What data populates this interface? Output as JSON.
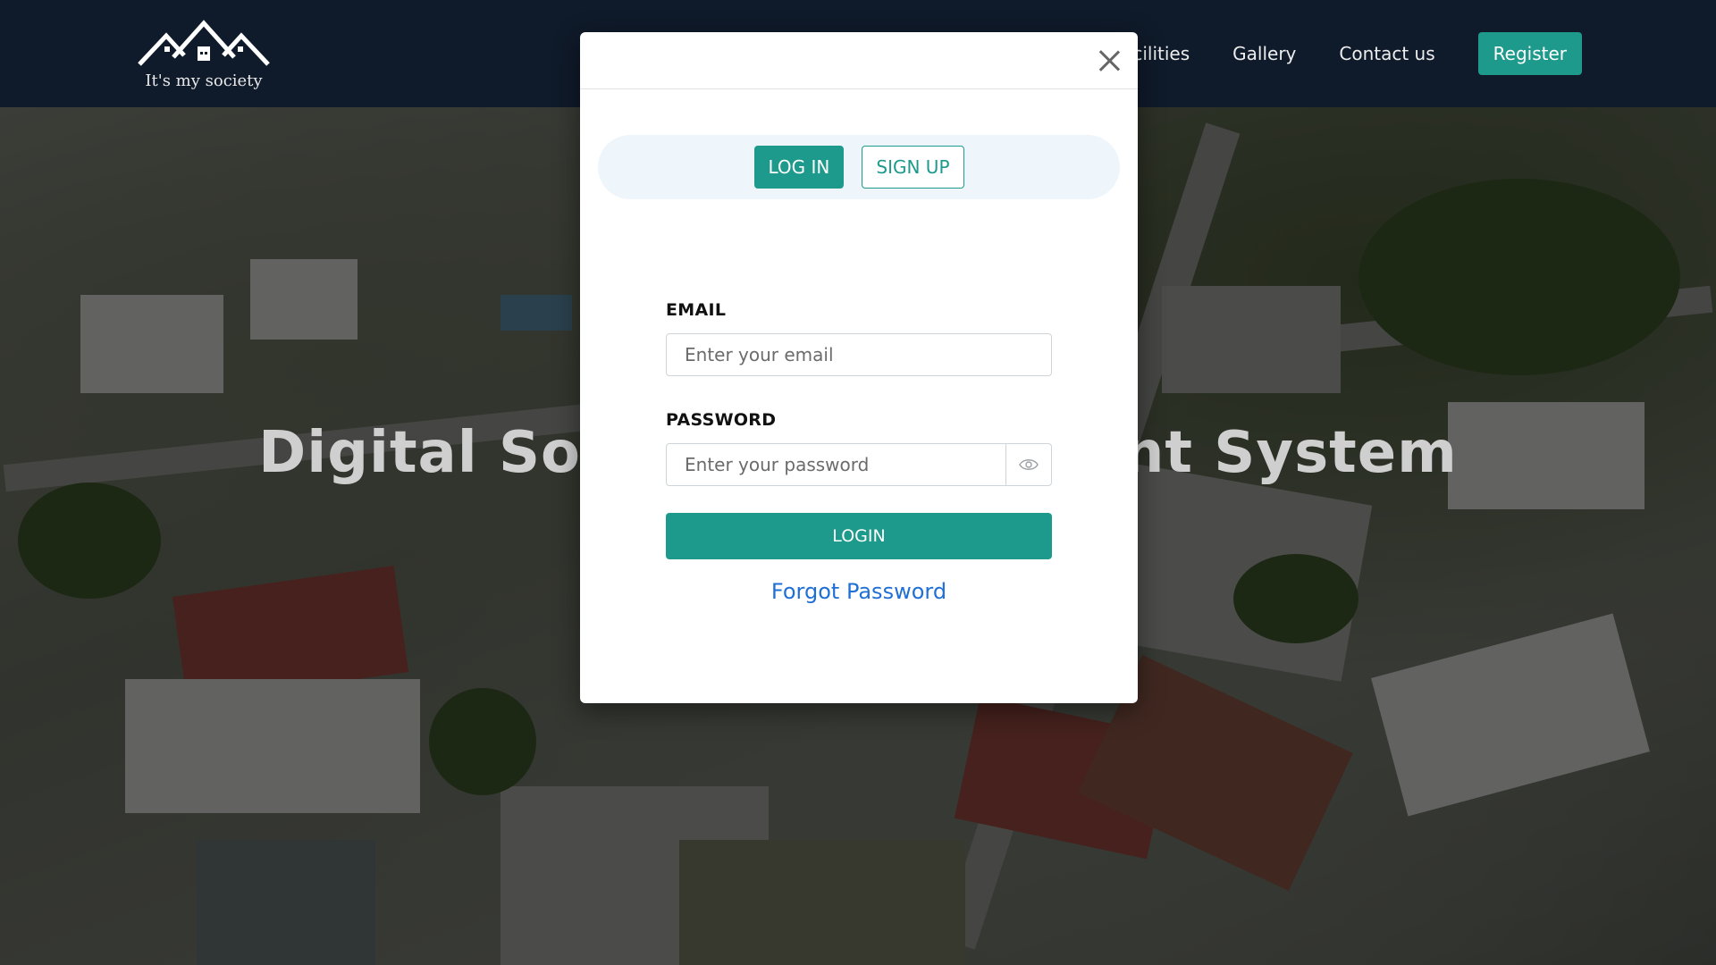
{
  "navbar": {
    "logo_text": "It's my society",
    "links": [
      "Facilities",
      "Gallery",
      "Contact us"
    ],
    "register_label": "Register"
  },
  "hero": {
    "title": "Digital Society Management System"
  },
  "modal": {
    "tabs": [
      {
        "label": "LOG IN",
        "active": true
      },
      {
        "label": "SIGN UP",
        "active": false
      }
    ],
    "email": {
      "label": "EMAIL",
      "placeholder": "Enter your email",
      "value": ""
    },
    "password": {
      "label": "PASSWORD",
      "placeholder": "Enter your password",
      "value": ""
    },
    "login_label": "LOGIN",
    "forgot_label": "Forgot Password"
  },
  "colors": {
    "navbar_bg": "#0f1a2a",
    "accent": "#1d9a8c",
    "link": "#1f6fd6",
    "tab_strip_bg": "#eef5fb"
  },
  "icons": [
    "logo-houses-icon",
    "close-icon",
    "eye-icon"
  ]
}
